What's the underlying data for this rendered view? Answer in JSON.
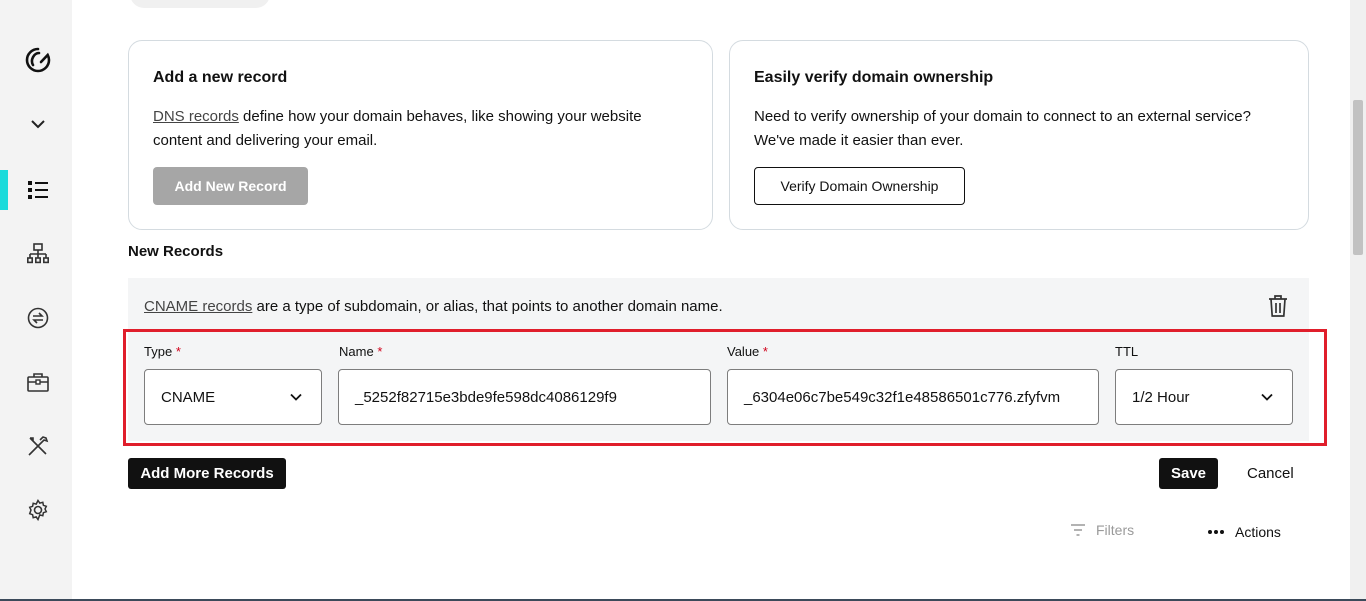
{
  "sidebar": {
    "items": [
      {
        "icon": "godaddy-logo-icon"
      },
      {
        "icon": "chevron-down-icon"
      },
      {
        "icon": "dns-list-icon",
        "active": true
      },
      {
        "icon": "sitemap-icon"
      },
      {
        "icon": "transfer-icon"
      },
      {
        "icon": "briefcase-icon"
      },
      {
        "icon": "tools-icon"
      },
      {
        "icon": "settings-gear-icon"
      }
    ],
    "accent_color": "#1bdbdb"
  },
  "add_record_card": {
    "title": "Add a new record",
    "link_text": "DNS records",
    "description_rest": " define how your domain behaves, like showing your website content and delivering your email.",
    "button_label": "Add New Record"
  },
  "verify_card": {
    "title": "Easily verify domain ownership",
    "description": "Need to verify ownership of your domain to connect to an external service? We've made it easier than ever.",
    "button_label": "Verify Domain Ownership"
  },
  "new_records": {
    "section_title": "New Records",
    "link_text": "CNAME records",
    "description_rest": " are a type of subdomain, or alias, that points to another domain name.",
    "fields": {
      "type_label": "Type",
      "type_value": "CNAME",
      "name_label": "Name",
      "name_value": "_5252f82715e3bde9fe598dc4086129f9",
      "value_label": "Value",
      "value_value": "_6304e06c7be549c32f1e48586501c776.zfyfvm",
      "ttl_label": "TTL",
      "ttl_value": "1/2 Hour",
      "required_marker": "*"
    },
    "add_more_label": "Add More Records",
    "save_label": "Save",
    "cancel_label": "Cancel"
  },
  "toolbar": {
    "filters_label": "Filters",
    "actions_label": "Actions"
  },
  "colors": {
    "highlight": "#e01e2b",
    "required": "#d0021b",
    "dark_button": "#111111",
    "disabled_button": "#a6a6a6"
  }
}
